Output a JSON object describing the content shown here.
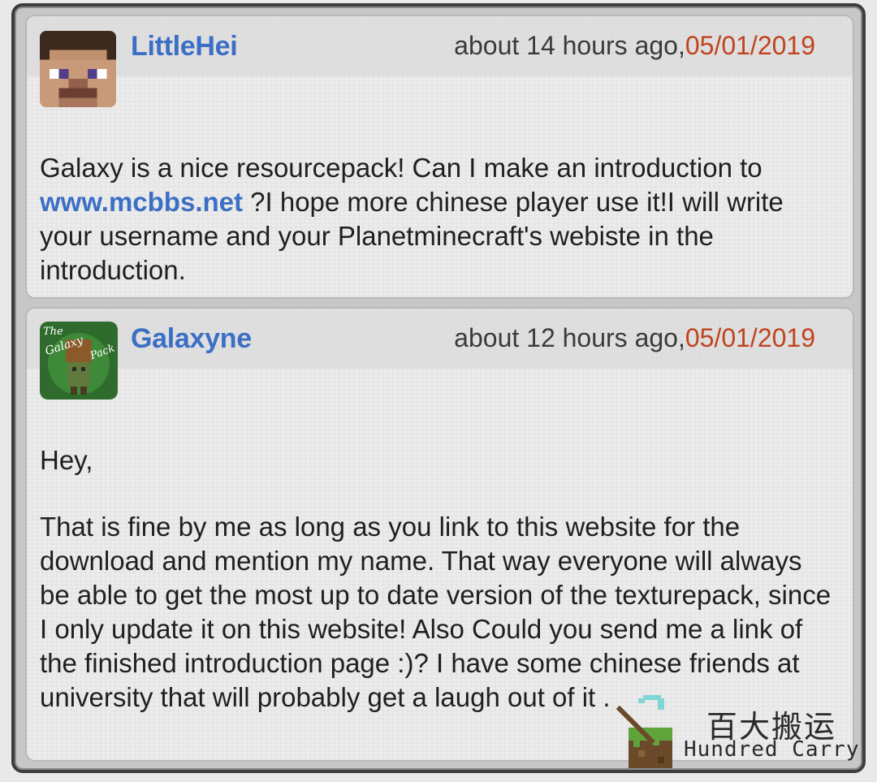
{
  "comments": [
    {
      "username": "LittleHei",
      "time_ago": "about 14 hours ago,",
      "date": "05/01/2019",
      "body_pre": "Galaxy is a nice resourcepack! Can I make an introduction to ",
      "body_link": "www.mcbbs.net",
      "body_post": " ?I hope more chinese player use it!I will write your username and your Planetminecraft's webiste in the introduction."
    },
    {
      "username": "Galaxyne",
      "time_ago": "about 12 hours ago,",
      "date": "05/01/2019",
      "avatar_text": "The Galaxy Pack",
      "greeting": "Hey,",
      "body": "That is fine by me as long as you link to this website for the download and mention my name. That way everyone will always be able to get the most up to date version of the texturepack, since I only update it on this website! Also Could you send me a link of the finished introduction page :)? I have some chinese friends at university that will probably get a laugh out of it ."
    }
  ],
  "watermark": {
    "cn": "百大搬运",
    "en": "Hundred Carry"
  },
  "icons": {
    "avatar_1": "steve-head-icon",
    "avatar_2": "galaxy-pack-logo-icon",
    "watermark": "pickaxe-grass-block-icon"
  },
  "colors": {
    "username": "#3b6fc5",
    "date": "#c0431e",
    "link": "#3b6fc5"
  }
}
